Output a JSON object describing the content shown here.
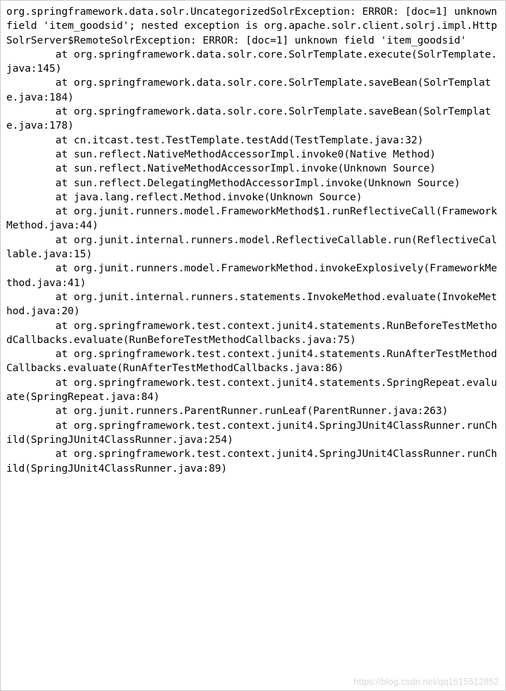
{
  "stacktrace": {
    "lines": [
      "org.springframework.data.solr.UncategorizedSolrException: ERROR: [doc=1] unknown field 'item_goodsid'; nested exception is org.apache.solr.client.solrj.impl.HttpSolrServer$RemoteSolrException: ERROR: [doc=1] unknown field 'item_goodsid'",
      "\tat org.springframework.data.solr.core.SolrTemplate.execute(SolrTemplate.java:145)",
      "\tat org.springframework.data.solr.core.SolrTemplate.saveBean(SolrTemplate.java:184)",
      "\tat org.springframework.data.solr.core.SolrTemplate.saveBean(SolrTemplate.java:178)",
      "\tat cn.itcast.test.TestTemplate.testAdd(TestTemplate.java:32)",
      "\tat sun.reflect.NativeMethodAccessorImpl.invoke0(Native Method)",
      "\tat sun.reflect.NativeMethodAccessorImpl.invoke(Unknown Source)",
      "\tat sun.reflect.DelegatingMethodAccessorImpl.invoke(Unknown Source)",
      "\tat java.lang.reflect.Method.invoke(Unknown Source)",
      "\tat org.junit.runners.model.FrameworkMethod$1.runReflectiveCall(FrameworkMethod.java:44)",
      "\tat org.junit.internal.runners.model.ReflectiveCallable.run(ReflectiveCallable.java:15)",
      "\tat org.junit.runners.model.FrameworkMethod.invokeExplosively(FrameworkMethod.java:41)",
      "\tat org.junit.internal.runners.statements.InvokeMethod.evaluate(InvokeMethod.java:20)",
      "\tat org.springframework.test.context.junit4.statements.RunBeforeTestMethodCallbacks.evaluate(RunBeforeTestMethodCallbacks.java:75)",
      "\tat org.springframework.test.context.junit4.statements.RunAfterTestMethodCallbacks.evaluate(RunAfterTestMethodCallbacks.java:86)",
      "\tat org.springframework.test.context.junit4.statements.SpringRepeat.evaluate(SpringRepeat.java:84)",
      "\tat org.junit.runners.ParentRunner.runLeaf(ParentRunner.java:263)",
      "\tat org.springframework.test.context.junit4.SpringJUnit4ClassRunner.runChild(SpringJUnit4ClassRunner.java:254)",
      "\tat org.springframework.test.context.junit4.SpringJUnit4ClassRunner.runChild(SpringJUnit4ClassRunner.java:89)"
    ]
  },
  "watermark": "https://blog.csdn.net/qq1515512852"
}
